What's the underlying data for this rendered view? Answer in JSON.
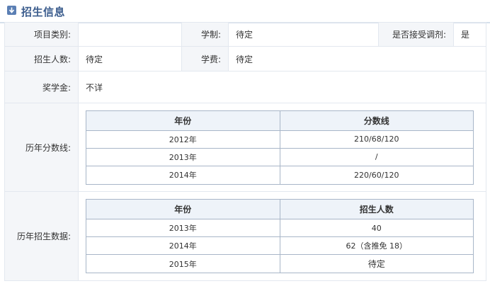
{
  "section": {
    "title": "招生信息",
    "icon": "collapse-arrow-down-icon",
    "accent_color": "#3d5e8e"
  },
  "info": {
    "project_type_label": "项目类别:",
    "project_type_value": "",
    "system_label": "学制:",
    "system_value": "待定",
    "adjust_label": "是否接受调剂:",
    "adjust_value": "是",
    "enroll_count_label": "招生人数:",
    "enroll_count_value": "待定",
    "tuition_label": "学费:",
    "tuition_value": "待定",
    "scholarship_label": "奖学金:",
    "scholarship_value": "不详"
  },
  "score_history": {
    "label": "历年分数线:",
    "headers": [
      "年份",
      "分数线"
    ],
    "rows": [
      [
        "2012年",
        "210/68/120"
      ],
      [
        "2013年",
        "/"
      ],
      [
        "2014年",
        "220/60/120"
      ]
    ]
  },
  "enroll_history": {
    "label": "历年招生数据:",
    "headers": [
      "年份",
      "招生人数"
    ],
    "rows": [
      [
        "2013年",
        "40"
      ],
      [
        "2014年",
        "62（含推免 18）"
      ],
      [
        "2015年",
        "待定"
      ]
    ]
  }
}
